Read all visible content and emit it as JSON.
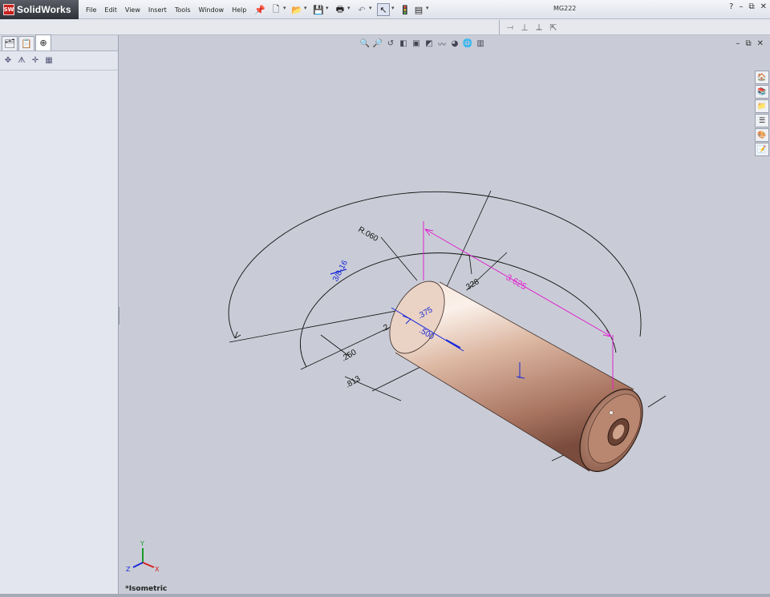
{
  "app": {
    "brand": "SolidWorks",
    "logo_mark": "SW",
    "doc_title": "MG222"
  },
  "menu": [
    "File",
    "Edit",
    "View",
    "Insert",
    "Tools",
    "Window",
    "Help"
  ],
  "toolbar": [
    "pin-icon",
    "new-icon",
    "open-icon",
    "save-icon",
    "print-icon",
    "undo-icon",
    "select-icon",
    "rebuild-icon",
    "options-icon"
  ],
  "window_controls": {
    "help": "?",
    "minimize": "–",
    "restore": "⧉",
    "close": "✕"
  },
  "view": {
    "label": "*Isometric",
    "triad": {
      "x": "X",
      "y": "Y",
      "z": "Z"
    }
  },
  "dimensions": {
    "length": "3.625",
    "fillet": "R.060",
    "d1": ".328",
    "d2": ".250",
    "d3": ".813",
    "d4": ".375",
    "d5": ".500",
    "d6": ".2",
    "thread": "3/8-16"
  },
  "colors": {
    "viewport_bg": "#c9ccd6",
    "driving_dim": "#1a2ad8",
    "reference_dim": "#e020d0",
    "part_body": "#c89a84"
  }
}
